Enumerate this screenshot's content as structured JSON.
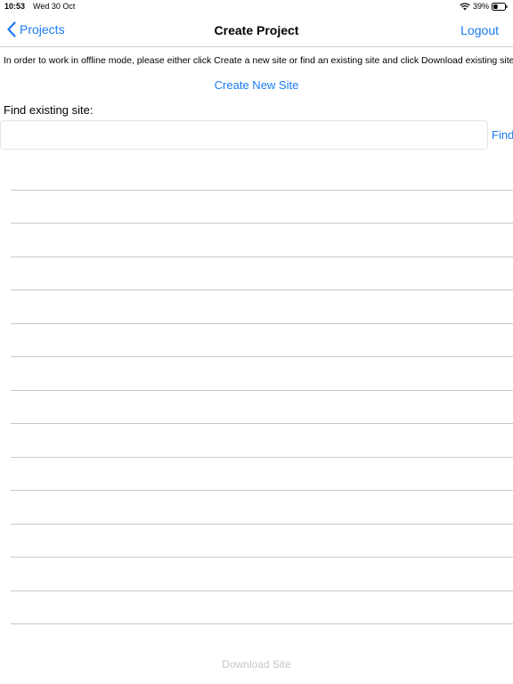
{
  "status_bar": {
    "time": "10:53",
    "date": "Wed 30 Oct",
    "battery_percent": "39%",
    "battery_level": 0.39,
    "icons": [
      "wifi-icon",
      "battery-icon"
    ]
  },
  "nav": {
    "back_label": "Projects",
    "title": "Create Project",
    "logout_label": "Logout"
  },
  "content": {
    "instructions": "In order to work in offline mode, please either click Create a new site or find an existing site and click Download existing site.",
    "create_new_site_label": "Create New Site",
    "find_label": "Find existing site:",
    "search_value": "",
    "search_placeholder": "",
    "find_button_label": "Find",
    "download_button_label": "Download Site"
  },
  "results": [
    "",
    "",
    "",
    "",
    "",
    "",
    "",
    "",
    "",
    "",
    "",
    "",
    "",
    ""
  ],
  "colors": {
    "accent": "#1a7cf0",
    "disabled": "#c7c7cc",
    "separator": "#c8c8cc"
  }
}
